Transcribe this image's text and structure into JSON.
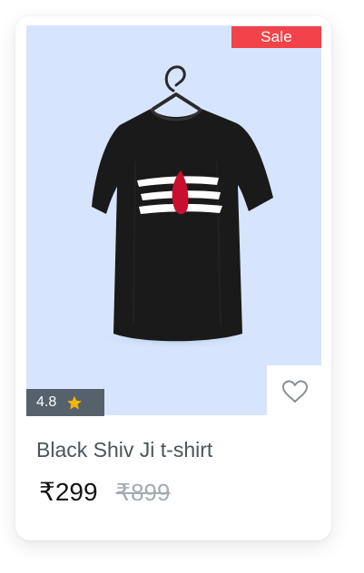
{
  "card": {
    "badge_label": "Sale",
    "rating_value": "4.8",
    "rating_icon": "star-icon",
    "wishlist_icon": "heart-outline-icon",
    "product_title": "Black Shiv Ji t-shirt",
    "price": "₹299",
    "original_price": "₹899"
  },
  "colors": {
    "image_background": "#d6e5fd",
    "badge": "#f2434a",
    "rating_background": "#56616b",
    "star": "#f5b700",
    "tshirt": "#1a1a1a",
    "tilak_red": "#c8102e"
  }
}
